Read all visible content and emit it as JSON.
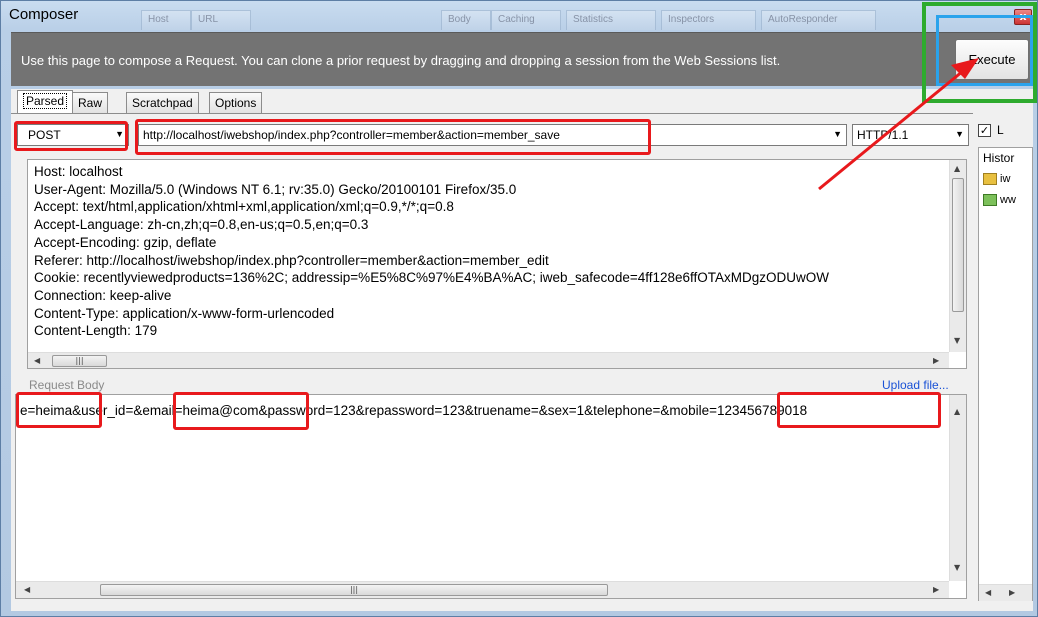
{
  "window": {
    "title": "Composer",
    "close_label": "x"
  },
  "background_tabs": [
    "Host",
    "URL",
    "Body",
    "Caching",
    "Statistics",
    "Inspectors",
    "AutoResponder"
  ],
  "banner": {
    "text": "Use this page to compose a Request. You can clone a prior request by dragging and dropping a session from the Web Sessions list.",
    "execute_label": "Execute"
  },
  "tabs": [
    "Parsed",
    "Raw",
    "Scratchpad",
    "Options"
  ],
  "request": {
    "method": "POST",
    "url": "http://localhost/iwebshop/index.php?controller=member&action=member_save",
    "version": "HTTP/1.1"
  },
  "headers": [
    "Host: localhost",
    "User-Agent: Mozilla/5.0 (Windows NT 6.1; rv:35.0) Gecko/20100101 Firefox/35.0",
    "Accept: text/html,application/xhtml+xml,application/xml;q=0.9,*/*;q=0.8",
    "Accept-Language: zh-cn,zh;q=0.8,en-us;q=0.5,en;q=0.3",
    "Accept-Encoding: gzip, deflate",
    "Referer: http://localhost/iwebshop/index.php?controller=member&action=member_edit",
    "Cookie: recentlyviewedproducts=136%2C; addressip=%E5%8C%97%E4%BA%AC; iweb_safecode=4ff128e6ffOTAxMDgzODUwOW",
    "Connection: keep-alive",
    "Content-Type: application/x-www-form-urlencoded",
    "Content-Length: 179"
  ],
  "request_body": {
    "label": "Request Body",
    "upload_link": "Upload file...",
    "text": "e=heima&user_id=&email=heima@com&password=123&repassword=123&truename=&sex=1&telephone=&mobile=123456789018"
  },
  "side": {
    "checkbox_label": "L",
    "history_title": "Histor",
    "history_items": [
      "iw",
      "ww"
    ]
  },
  "icons": {
    "check": "checkmark-icon",
    "dropdown": "chevron-down-icon",
    "scroll_up": "scroll-up-icon",
    "scroll_down": "scroll-down-icon",
    "scroll_left": "scroll-left-icon",
    "scroll_right": "scroll-right-icon"
  },
  "annotation_colors": {
    "highlight": "#e8191c",
    "outer_box": "#2eab2e",
    "inner_box": "#2aa3ec"
  }
}
